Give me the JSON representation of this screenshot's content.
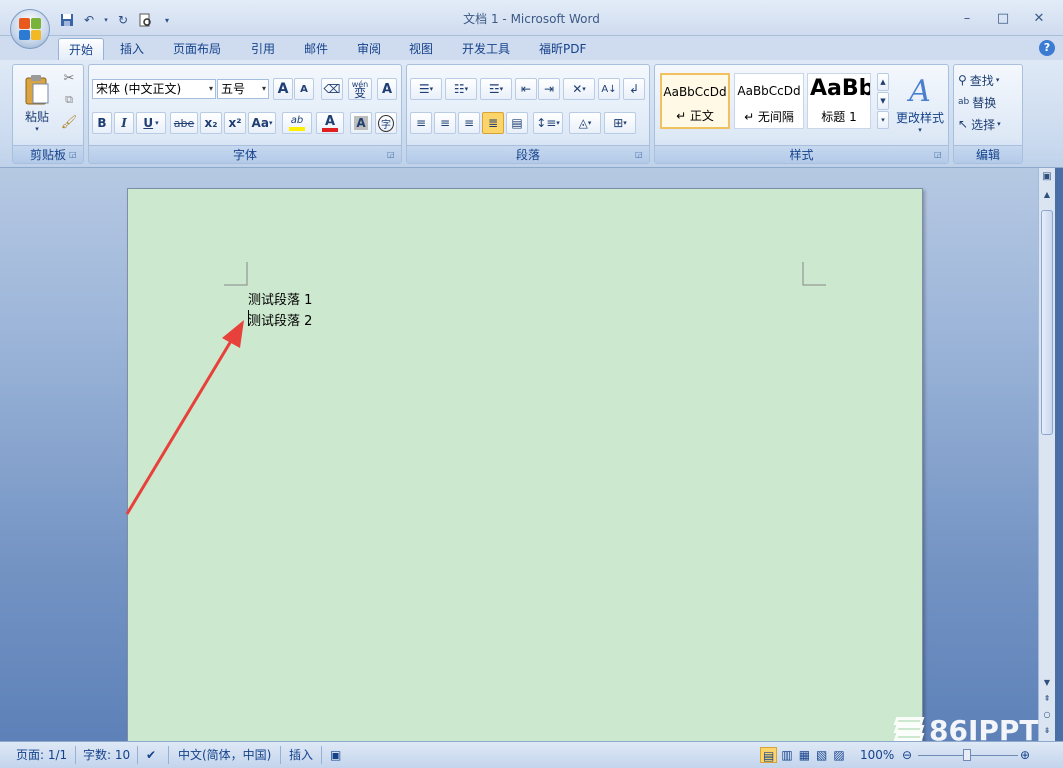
{
  "window": {
    "title": "文档 1 - Microsoft Word",
    "minimize": "–",
    "maximize": "□",
    "close": "✕"
  },
  "tabs": [
    {
      "label": "开始",
      "active": true
    },
    {
      "label": "插入"
    },
    {
      "label": "页面布局"
    },
    {
      "label": "引用"
    },
    {
      "label": "邮件"
    },
    {
      "label": "审阅"
    },
    {
      "label": "视图"
    },
    {
      "label": "开发工具"
    },
    {
      "label": "福昕PDF"
    }
  ],
  "ribbon": {
    "clipboard": {
      "paste_label": "粘贴",
      "group_label": "剪贴板"
    },
    "font": {
      "font_name": "宋体 (中文正文)",
      "font_size": "五号",
      "group_label": "字体",
      "bold": "B",
      "italic": "I",
      "underline": "U",
      "strike": "abe",
      "subscript": "x₂",
      "superscript": "x²",
      "change_case": "Aa",
      "grow": "A",
      "shrink": "A",
      "char_border": "A",
      "char_shading": "A",
      "wen_label": "wén",
      "wen_char": "变",
      "enclose": "字",
      "font_color": "A",
      "highlight": "ab"
    },
    "paragraph": {
      "group_label": "段落"
    },
    "styles": {
      "group_label": "样式",
      "change_styles": "更改样式",
      "tiles": [
        {
          "sample": "AaBbCcDd",
          "name": "↵ 正文",
          "selected": true
        },
        {
          "sample": "AaBbCcDd",
          "name": "↵ 无间隔"
        },
        {
          "sample": "AaBb",
          "name": "标题 1"
        }
      ]
    },
    "editing": {
      "group_label": "编辑",
      "find": "查找",
      "replace": "替换",
      "select": "选择"
    }
  },
  "document": {
    "paragraphs": [
      "测试段落 1",
      "测试段落 2"
    ]
  },
  "status": {
    "page": "页面: 1/1",
    "words": "字数: 10",
    "language": "中文(简体，中国)",
    "mode": "插入",
    "zoom": "100%"
  },
  "watermark": "86IPPT",
  "colors": {
    "page_bg": "#cce8cf",
    "arrow": "#e8403a",
    "accent": "#15428b"
  }
}
